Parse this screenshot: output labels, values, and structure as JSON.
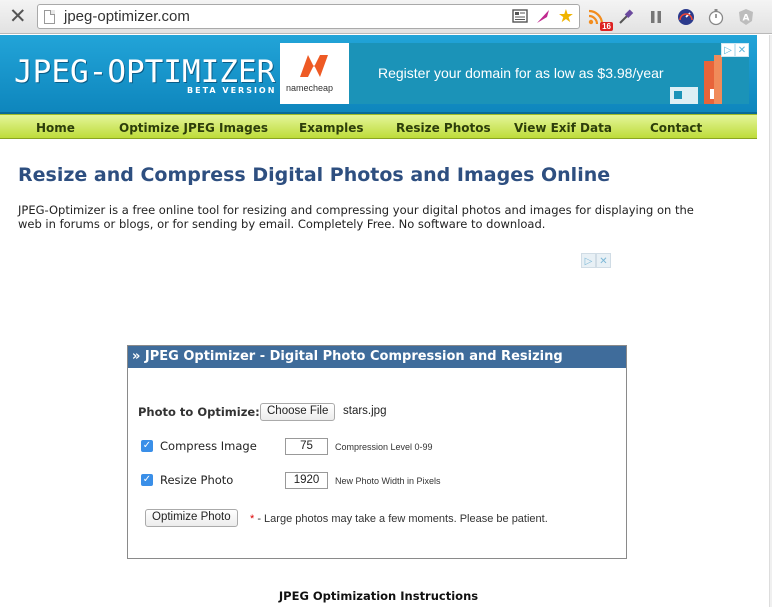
{
  "browser": {
    "url": "jpeg-optimizer.com",
    "extension_badge": "16"
  },
  "site": {
    "logo": "JPEG-OPTIMIZER",
    "logo_sub": "BETA VERSION"
  },
  "ad": {
    "brand": "namecheap",
    "text": "Register your domain for as low as $3.98/year"
  },
  "nav": {
    "items": [
      "Home",
      "Optimize JPEG Images",
      "Examples",
      "Resize Photos",
      "View Exif Data",
      "Contact"
    ]
  },
  "main": {
    "heading": "Resize and Compress Digital Photos and Images Online",
    "intro": "JPEG-Optimizer is a free online tool for resizing and compressing your digital photos and images for displaying on the web in forums or blogs, or for sending by email. Completely Free. No software to download."
  },
  "form": {
    "title": "» JPEG Optimizer - Digital Photo Compression and Resizing",
    "photo_label": "Photo to Optimize:",
    "choose_file_label": "Choose File",
    "file_name": "stars.jpg",
    "compress_label": "Compress Image",
    "compress_value": "75",
    "compress_hint": "Compression Level 0-99",
    "resize_label": "Resize Photo",
    "resize_value": "1920",
    "resize_hint": "New Photo Width in Pixels",
    "submit_label": "Optimize Photo",
    "note_star": "*",
    "note": " - Large photos may take a few moments. Please be patient."
  },
  "footer": {
    "instructions_heading": "JPEG Optimization Instructions"
  }
}
